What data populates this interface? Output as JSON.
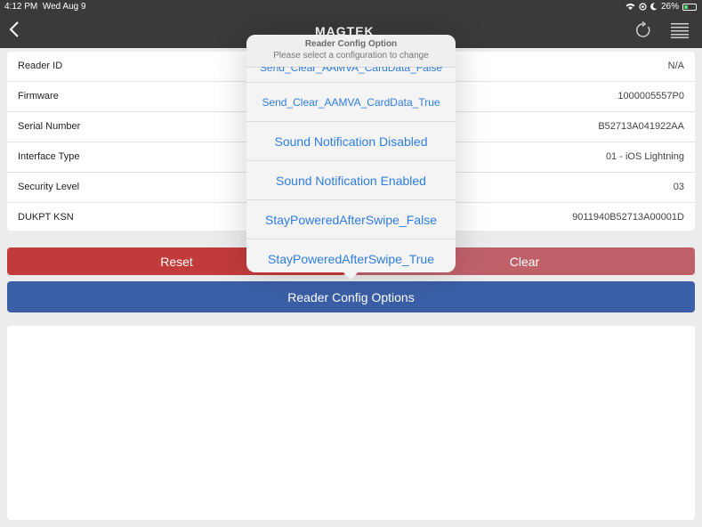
{
  "status": {
    "time": "4:12 PM",
    "date": "Wed Aug 9",
    "battery": "26%"
  },
  "nav": {
    "logo": "MAGTEK"
  },
  "info_rows": [
    {
      "label": "Reader ID",
      "value": "N/A"
    },
    {
      "label": "Firmware",
      "value": "1000005557P0"
    },
    {
      "label": "Serial Number",
      "value": "B52713A041922AA"
    },
    {
      "label": "Interface Type",
      "value": "01 - iOS Lightning"
    },
    {
      "label": "Security Level",
      "value": "03"
    },
    {
      "label": "DUKPT KSN",
      "value": "9011940B52713A00001D"
    }
  ],
  "buttons": {
    "reset": "Reset",
    "clear": "Clear",
    "config": "Reader Config Options"
  },
  "popover": {
    "title": "Reader Config Option",
    "subtitle": "Please select a configuration to change",
    "options": [
      "Send_Clear_AAMVA_CardData_False",
      "Send_Clear_AAMVA_CardData_True",
      "Sound Notification Disabled",
      "Sound Notification Enabled",
      "StayPoweredAfterSwipe_False",
      "StayPoweredAfterSwipe_True"
    ]
  },
  "colors": {
    "link": "#2f7de1",
    "reset": "#c23b3b",
    "clear": "#c0616a",
    "config": "#3b5fa7"
  }
}
